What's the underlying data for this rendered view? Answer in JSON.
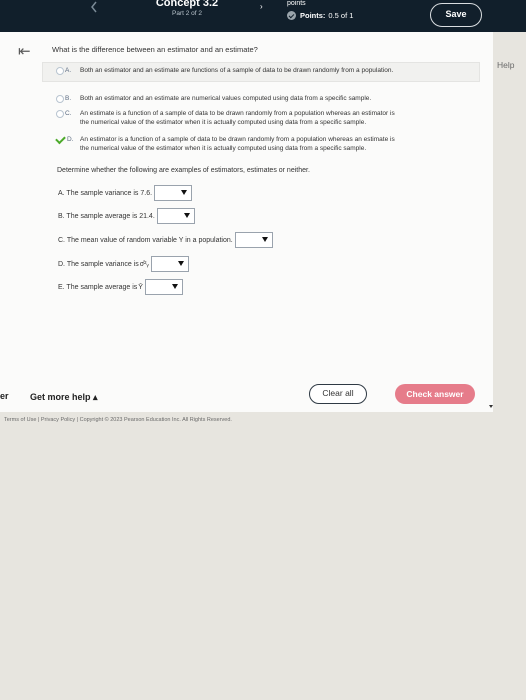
{
  "header": {
    "concept_title": "Concept 3.2",
    "part": "Part 2 of 2",
    "points_label": "points",
    "points_prefix": "Points:",
    "points_value": "0.5 of 1",
    "save_label": "Save"
  },
  "sidebar": {
    "help_tab": "Help"
  },
  "question": {
    "prompt": "What is the difference between an estimator and an estimate?",
    "choices": [
      {
        "letter": "A.",
        "text": "Both an estimator and an estimate are functions of a sample of data to be drawn randomly from a population."
      },
      {
        "letter": "B.",
        "text": "Both an estimator and an estimate are numerical values computed using data from a specific sample."
      },
      {
        "letter": "C.",
        "line1": "An estimate is a function of a sample of data to be drawn randomly from a population whereas an estimator is",
        "line2": "the numerical value of the estimator when it is actually computed using data from a specific sample."
      },
      {
        "letter": "D.",
        "line1": "An estimator is a function of a sample of data to be drawn randomly from a population whereas an estimate is",
        "line2": "the numerical value of the estimator when it is actually computed using data from a specific sample."
      }
    ]
  },
  "part2": {
    "instruction": "Determine whether the following are examples of estimators, estimates or neither.",
    "items": [
      {
        "text": "A. The sample variance is 7.6."
      },
      {
        "text": "B. The sample average is 21.4."
      },
      {
        "text": "C. The mean value of random variable Y in a population."
      },
      {
        "text": "D. The sample variance is ",
        "symbol": "σ̂²ᵧ"
      },
      {
        "text": "E. The sample average is ",
        "symbol": "Ȳ"
      }
    ]
  },
  "footer_bar": {
    "left_cut_label": "er",
    "get_more_help": "Get more help ▴",
    "clear_all": "Clear all",
    "check_answer": "Check answer"
  },
  "legal": {
    "text": "Terms of Use | Privacy Policy | Copyright © 2023 Pearson Education Inc. All Rights Reserved."
  },
  "colors": {
    "topbar": "#111f2b",
    "check_answer_bg": "#e67c8a",
    "correct_check": "#4caa2a"
  }
}
